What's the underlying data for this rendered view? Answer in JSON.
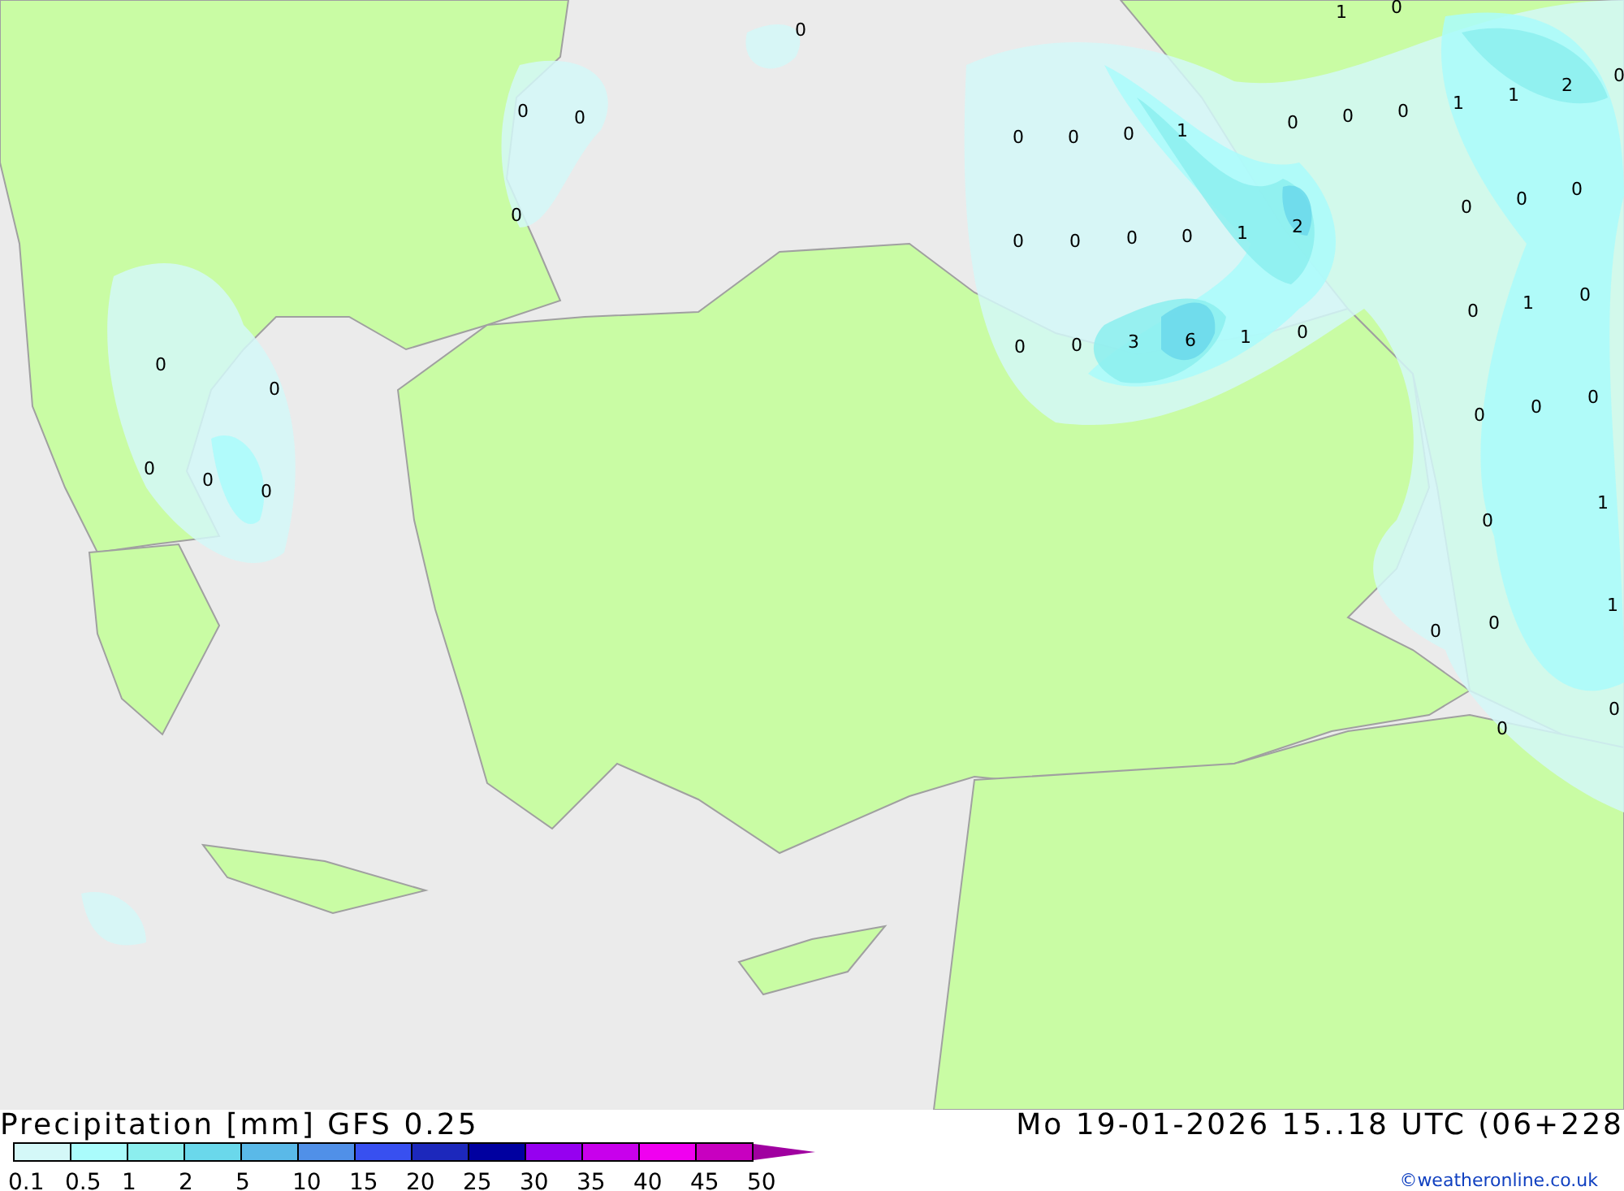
{
  "map": {
    "labels": [
      "0",
      "1",
      "0",
      "0",
      "0",
      "0",
      "0",
      "0",
      "0",
      "1",
      "0",
      "0",
      "0",
      "1",
      "1",
      "2",
      "0",
      "0",
      "0",
      "0",
      "0",
      "1",
      "2",
      "0",
      "0",
      "0",
      "0",
      "0",
      "3",
      "6",
      "1",
      "0",
      "0",
      "1",
      "0",
      "0",
      "0",
      "0",
      "0",
      "0",
      "0",
      "0",
      "0",
      "0",
      "1",
      "0",
      "0",
      "1",
      "0",
      "0"
    ]
  },
  "title": "Precipitation [mm] GFS 0.25",
  "valid_time": "Mo 19-01-2026 15..18 UTC (06+228",
  "legend": {
    "bins": [
      {
        "color": "#d4f8f8"
      },
      {
        "color": "#aafcfc"
      },
      {
        "color": "#8ceeee"
      },
      {
        "color": "#6ad8eb"
      },
      {
        "color": "#5ab9e8"
      },
      {
        "color": "#5090e8"
      },
      {
        "color": "#3850f0"
      },
      {
        "color": "#1c28bc"
      },
      {
        "color": "#0000a0"
      },
      {
        "color": "#9600f0"
      },
      {
        "color": "#c800ec"
      },
      {
        "color": "#f000f0"
      },
      {
        "color": "#c800c0"
      }
    ],
    "arrow": {
      "color": "#a000a0"
    },
    "labels": [
      "0.1",
      "0.5",
      "1",
      "2",
      "5",
      "10",
      "15",
      "20",
      "25",
      "30",
      "35",
      "40",
      "45",
      "50"
    ]
  },
  "credit": "©weatheronline.co.uk"
}
